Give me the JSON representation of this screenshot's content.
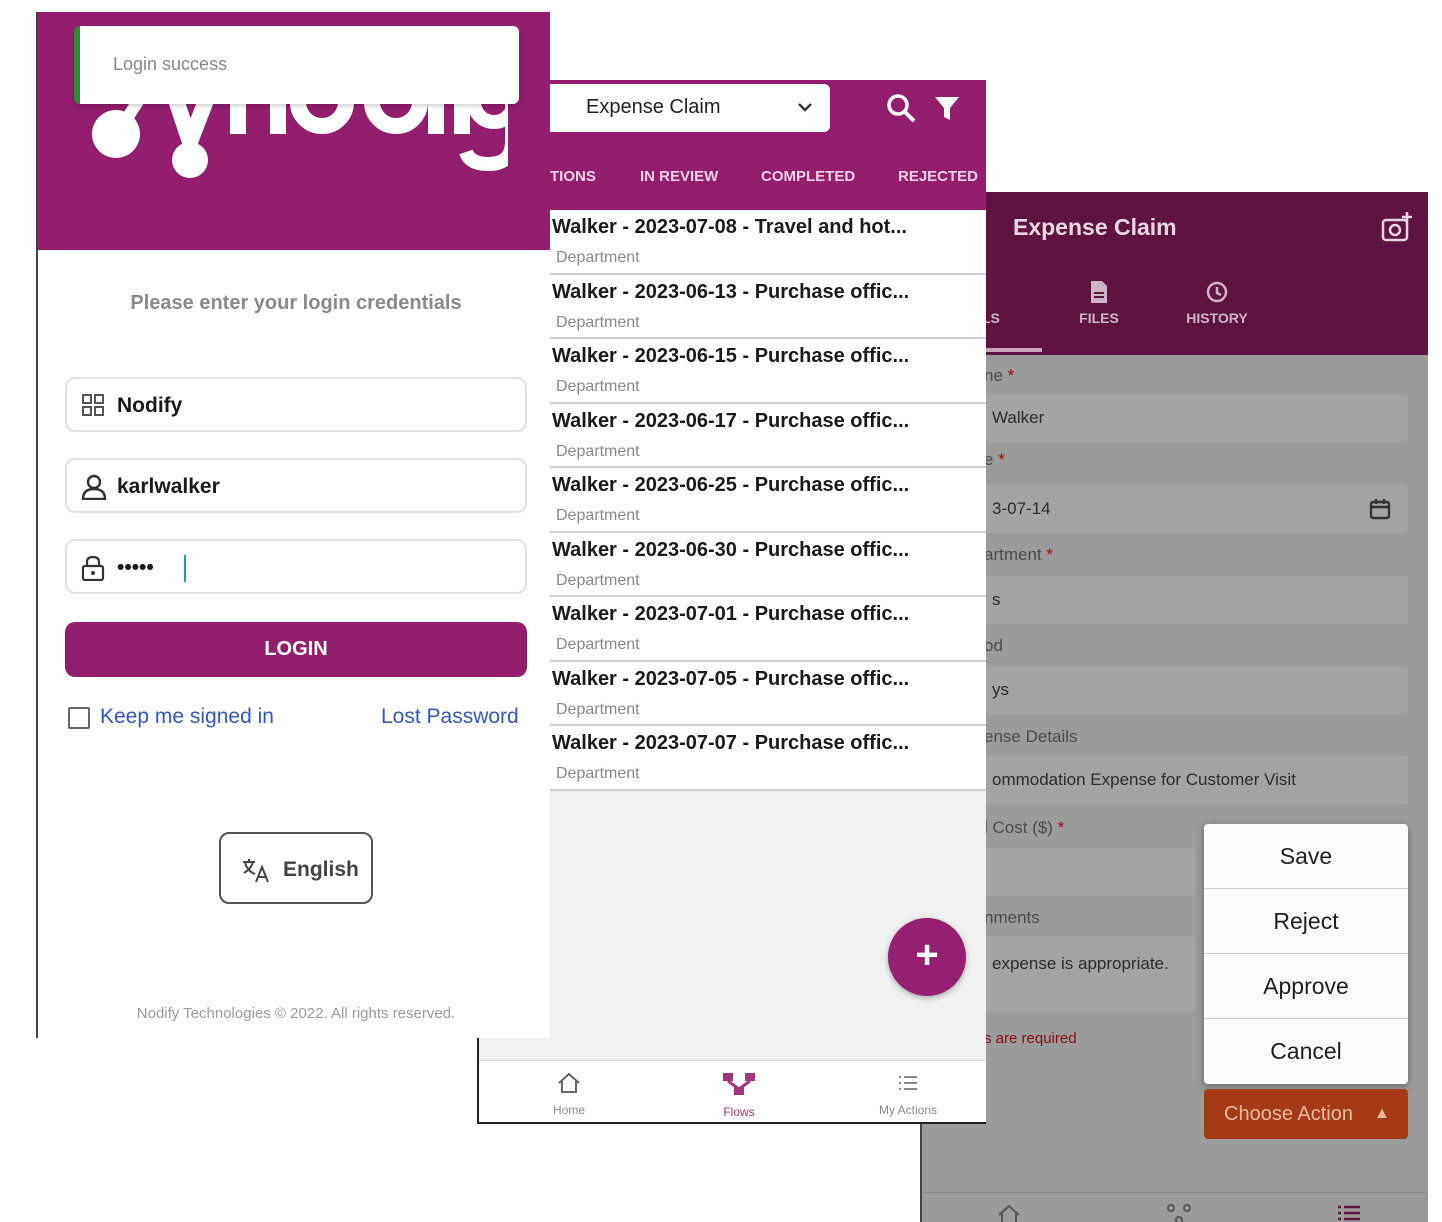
{
  "login": {
    "toast": "Login success",
    "prompt": "Please enter your login credentials",
    "company": "Nodify",
    "username": "karlwalker",
    "password_mask": "•••••",
    "login_button": "LOGIN",
    "keep_signed_in": "Keep me signed in",
    "lost_password": "Lost Password",
    "language": "English",
    "footer": "Nodify Technologies © 2022. All rights reserved.",
    "brand_color": "#941e6e"
  },
  "list": {
    "flow_select": "Expense Claim",
    "tabs": [
      "TIONS",
      "IN REVIEW",
      "COMPLETED",
      "REJECTED"
    ],
    "rows": [
      {
        "title": "Walker - 2023-07-08 - Travel and hot...",
        "sub": "Department"
      },
      {
        "title": "Walker - 2023-06-13 - Purchase offic...",
        "sub": "Department"
      },
      {
        "title": "Walker - 2023-06-15 - Purchase offic...",
        "sub": "Department"
      },
      {
        "title": "Walker - 2023-06-17 - Purchase offic...",
        "sub": "Department"
      },
      {
        "title": "Walker - 2023-06-25 - Purchase offic...",
        "sub": "Department"
      },
      {
        "title": "Walker - 2023-06-30 - Purchase offic...",
        "sub": "Department"
      },
      {
        "title": "Walker - 2023-07-01 - Purchase offic...",
        "sub": "Department"
      },
      {
        "title": "Walker - 2023-07-05 - Purchase offic...",
        "sub": "Department"
      },
      {
        "title": "Walker - 2023-07-07 - Purchase offic...",
        "sub": "Department"
      }
    ],
    "fab": "+",
    "nav": [
      "Home",
      "Flows",
      "My Actions"
    ]
  },
  "detail": {
    "title": "Expense Claim",
    "tabs": [
      "ILS",
      "FILES",
      "HISTORY"
    ],
    "fields": [
      {
        "label": "ne",
        "required": true,
        "value": "Walker"
      },
      {
        "label": "e",
        "required": true,
        "value": "3-07-14"
      },
      {
        "label": "artment",
        "required": true,
        "value": "s"
      },
      {
        "label": "od",
        "required": false,
        "value": "ys"
      },
      {
        "label": "ense Details",
        "required": false,
        "value": "ommodation Expense for Customer Visit"
      },
      {
        "label": "l Cost ($)",
        "required": true,
        "value": ""
      },
      {
        "label": "nments",
        "required": false,
        "value": "expense is appropriate."
      }
    ],
    "error": "s are required",
    "actions": [
      "Save",
      "Reject",
      "Approve",
      "Cancel"
    ],
    "choose_action": "Choose Action",
    "required_mark": "*"
  }
}
